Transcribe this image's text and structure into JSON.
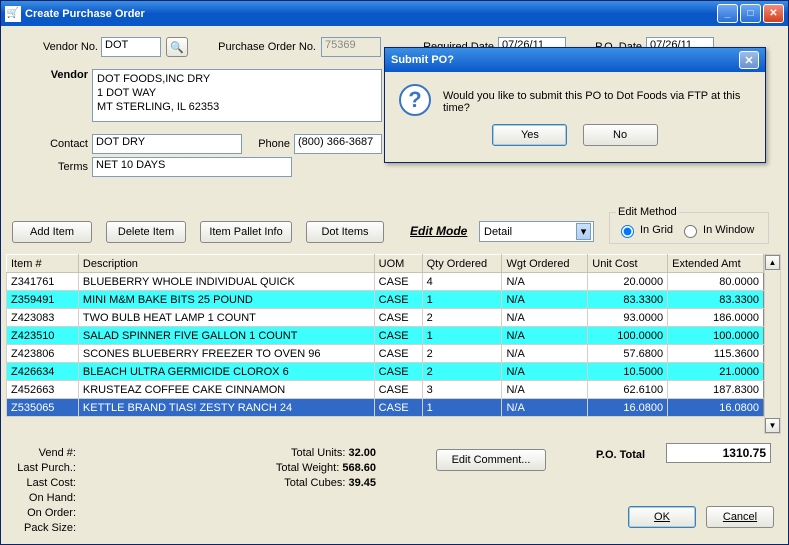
{
  "window": {
    "title": "Create Purchase Order"
  },
  "header": {
    "vendor_no_label": "Vendor No.",
    "vendor_no": "DOT",
    "po_no_label": "Purchase Order No.",
    "po_no": "75369",
    "required_date_label": "Required Date",
    "required_date": "07/26/11",
    "po_date_label": "P.O. Date",
    "po_date": "07/26/11"
  },
  "vendor": {
    "label": "Vendor",
    "lines": [
      "DOT FOODS,INC DRY",
      "1 DOT WAY",
      "MT STERLING, IL  62353"
    ],
    "contact_label": "Contact",
    "contact": "DOT DRY",
    "phone_label": "Phone",
    "phone": "(800) 366-3687",
    "terms_label": "Terms",
    "terms": "NET 10 DAYS"
  },
  "buttons": {
    "add_item": "Add Item",
    "delete_item": "Delete Item",
    "item_pallet_info": "Item Pallet Info",
    "dot_items": "Dot Items",
    "edit_comment": "Edit Comment...",
    "ok": "OK",
    "cancel": "Cancel"
  },
  "editmode": {
    "label": "Edit Mode",
    "value": "Detail"
  },
  "editmethod": {
    "legend": "Edit Method",
    "opt1": "In Grid",
    "opt2": "In Window"
  },
  "grid": {
    "columns": [
      "Item #",
      "Description",
      "UOM",
      "Qty Ordered",
      "Wgt Ordered",
      "Unit Cost",
      "Extended Amt"
    ],
    "rows": [
      {
        "item": "Z341761",
        "desc": "BLUEBERRY WHOLE INDIVIDUAL QUICK",
        "uom": "CASE",
        "qty": "4",
        "wgt": "N/A",
        "unit": "20.0000",
        "ext": "80.0000",
        "alt": false,
        "sel": false
      },
      {
        "item": "Z359491",
        "desc": "MINI M&M BAKE BITS 25 POUND",
        "uom": "CASE",
        "qty": "1",
        "wgt": "N/A",
        "unit": "83.3300",
        "ext": "83.3300",
        "alt": true,
        "sel": false
      },
      {
        "item": "Z423083",
        "desc": "TWO BULB HEAT LAMP 1 COUNT",
        "uom": "CASE",
        "qty": "2",
        "wgt": "N/A",
        "unit": "93.0000",
        "ext": "186.0000",
        "alt": false,
        "sel": false
      },
      {
        "item": "Z423510",
        "desc": "SALAD SPINNER FIVE GALLON 1 COUNT",
        "uom": "CASE",
        "qty": "1",
        "wgt": "N/A",
        "unit": "100.0000",
        "ext": "100.0000",
        "alt": true,
        "sel": false
      },
      {
        "item": "Z423806",
        "desc": "SCONES BLUEBERRY FREEZER TO OVEN 96",
        "uom": "CASE",
        "qty": "2",
        "wgt": "N/A",
        "unit": "57.6800",
        "ext": "115.3600",
        "alt": false,
        "sel": false
      },
      {
        "item": "Z426634",
        "desc": "BLEACH ULTRA GERMICIDE CLOROX 6",
        "uom": "CASE",
        "qty": "2",
        "wgt": "N/A",
        "unit": "10.5000",
        "ext": "21.0000",
        "alt": true,
        "sel": false
      },
      {
        "item": "Z452663",
        "desc": "KRUSTEAZ COFFEE CAKE CINNAMON",
        "uom": "CASE",
        "qty": "3",
        "wgt": "N/A",
        "unit": "62.6100",
        "ext": "187.8300",
        "alt": false,
        "sel": false
      },
      {
        "item": "Z535065",
        "desc": "KETTLE BRAND TIAS! ZESTY RANCH 24",
        "uom": "CASE",
        "qty": "1",
        "wgt": "N/A",
        "unit": "16.0800",
        "ext": "16.0800",
        "alt": false,
        "sel": true
      }
    ]
  },
  "summary": {
    "vend_num_lbl": "Vend #:",
    "last_purch_lbl": "Last Purch.:",
    "last_cost_lbl": "Last Cost:",
    "on_hand_lbl": "On Hand:",
    "on_order_lbl": "On Order:",
    "pack_size_lbl": "Pack Size:",
    "total_units_lbl": "Total Units:",
    "total_units": "32.00",
    "total_weight_lbl": "Total Weight:",
    "total_weight": "568.60",
    "total_cubes_lbl": "Total Cubes:",
    "total_cubes": "39.45"
  },
  "totals": {
    "label": "P.O. Total",
    "value": "1310.75"
  },
  "dialog": {
    "title": "Submit PO?",
    "message": "Would you like to submit this PO to Dot Foods via FTP at this time?",
    "yes": "Yes",
    "no": "No"
  }
}
